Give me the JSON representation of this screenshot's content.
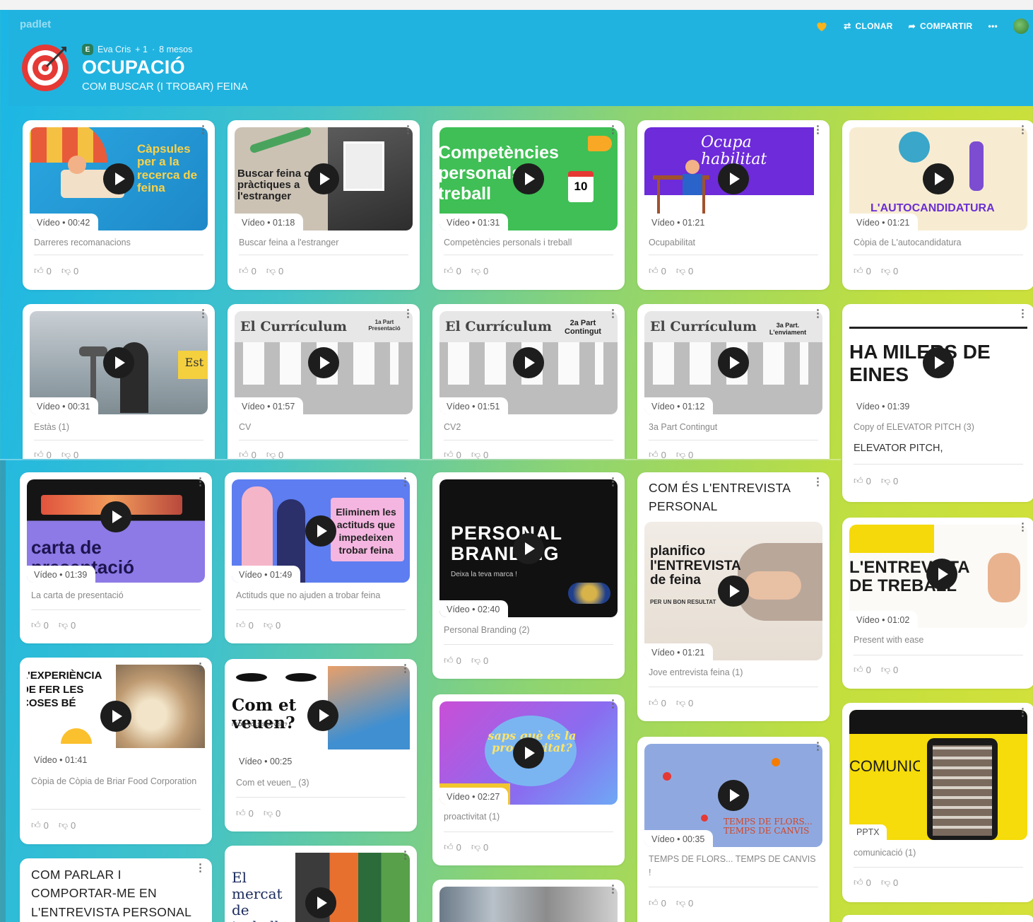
{
  "app": {
    "logo_text": "padlet"
  },
  "toolbar": {
    "clone": "CLONAR",
    "share": "COMPARTIR",
    "more": "•••"
  },
  "board": {
    "author": "Eva Cris",
    "collaborators": "+ 1",
    "separator": "·",
    "age": "8 mesos",
    "title": "OCUPACIÓ",
    "subtitle": "COM BUSCAR (I TROBAR) FEINA"
  },
  "colors": {
    "header": "#21b3e0",
    "accent_red": "#e53935"
  },
  "video_label": "Vídeo",
  "reactions": {
    "likes": "0",
    "dislikes": "0"
  },
  "cards": {
    "c1": {
      "duration": "00:42",
      "caption": "Darreres recomanacions",
      "thumb_text": "Càpsules per a la recerca de feina"
    },
    "c2": {
      "duration": "01:18",
      "caption": "Buscar feina a l'estranger",
      "thumb_text": "Buscar feina o pràctiques a l'estranger"
    },
    "c3": {
      "duration": "01:31",
      "caption": "Competències personals i treball",
      "thumb_text": "Competències personals i treball",
      "thumb_num": "10"
    },
    "c4": {
      "duration": "01:21",
      "caption": "Ocupabilitat",
      "thumb_text": "Ocupa habilitat"
    },
    "c5": {
      "duration": "01:21",
      "caption": "Còpia de L'autocandidatura",
      "thumb_text": "L'AUTOCANDIDATURA"
    },
    "c6": {
      "duration": "00:31",
      "caption": "Estàs (1)",
      "thumb_text": "Est"
    },
    "c7": {
      "duration": "01:57",
      "caption": "CV",
      "thumb_text": "El Currículum",
      "thumb_sub": "1a Part Presentació"
    },
    "c8": {
      "duration": "01:51",
      "caption": "CV2",
      "thumb_text": "El Currículum",
      "thumb_sub": "2a Part Contingut"
    },
    "c9": {
      "duration": "01:12",
      "caption": "3a Part Contingut",
      "thumb_text": "El Currículum",
      "thumb_sub": "3a Part. L'enviament"
    },
    "c10": {
      "duration": "01:39",
      "caption": "Copy of ELEVATOR PITCH (3)",
      "thumb_text": "HA MILERS DE EINES",
      "title": "ELEVATOR PITCH,"
    },
    "c11": {
      "duration": "01:39",
      "caption": "La carta de presentació",
      "thumb_text": "carta de presentació"
    },
    "c12": {
      "duration": "01:49",
      "caption": "Actituds que no ajuden a trobar feina",
      "thumb_text": "Eliminem les actituds que impedeixen trobar feina"
    },
    "c13": {
      "duration": "02:40",
      "caption": "Personal Branding (2)",
      "thumb_text": "PERSONAL BRANDING",
      "thumb_sub": "Deixa la teva marca !"
    },
    "c14": {
      "duration": "01:21",
      "caption": "Jove entrevista feina (1)",
      "title": "COM ÉS L'ENTREVISTA PERSONAL",
      "thumb_text": "planifico l'ENTREVISTA de feina",
      "thumb_sub": "PER UN BON RESULTAT"
    },
    "c15": {
      "duration": "01:02",
      "caption": "Present with ease",
      "thumb_text": "L'ENTREVISTA DE TREBALL"
    },
    "c16": {
      "duration": "01:41",
      "caption": "Còpia de Còpia de Briar Food Corporation",
      "thumb_text": "L'EXPERIÈNCIA DE FER LES COSES BÉ"
    },
    "c17": {
      "duration": "00:25",
      "caption": "Com et veuen_ (3)",
      "thumb_text": "Com et veuen?",
      "thumb_sub": "I COM VOLS SER VIST?"
    },
    "c18": {
      "duration": "02:27",
      "caption": "proactivitat (1)",
      "thumb_text": "saps què és la proactivitat?"
    },
    "c19": {
      "duration": "00:35",
      "caption": "TEMPS DE FLORS... TEMPS DE CANVIS !",
      "thumb_text": "TEMPS DE FLORS... TEMPS DE CANVIS"
    },
    "c20": {
      "tag": "PPTX",
      "caption": "comunicació (1)",
      "thumb_text": "COMUNICACIÓ"
    },
    "c21": {
      "title": "COM PARLAR I COMPORTAR-ME EN L'ENTREVISTA PERSONAL"
    },
    "c22": {
      "thumb_text": "El mercat de treball"
    }
  }
}
